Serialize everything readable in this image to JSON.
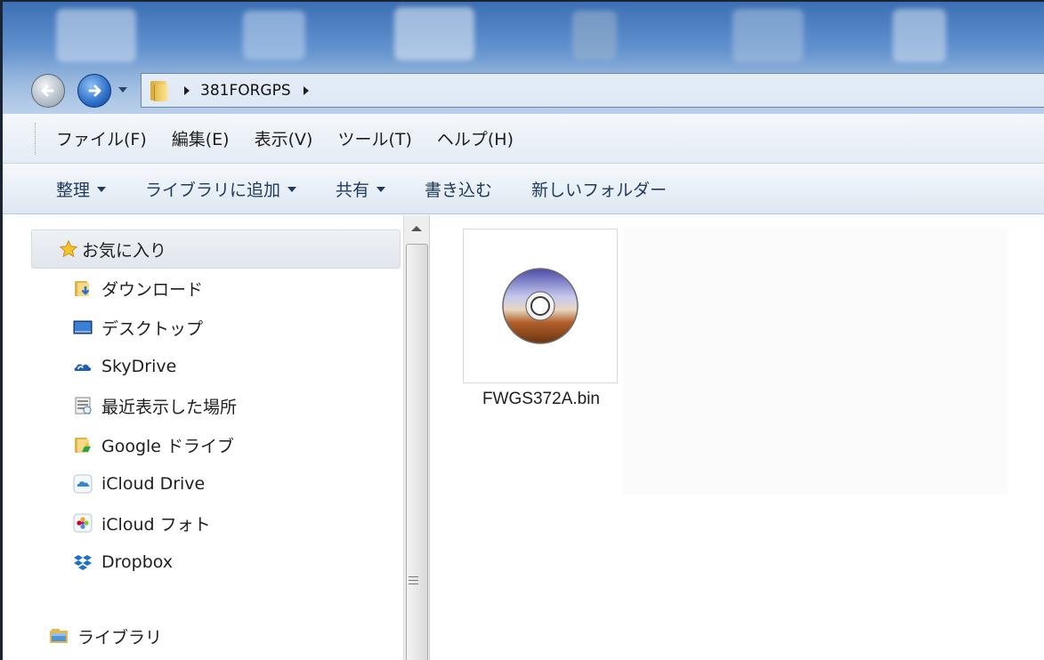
{
  "address_bar": {
    "breadcrumb": "381FORGPS"
  },
  "menu_bar": {
    "items": [
      "ファイル(F)",
      "編集(E)",
      "表示(V)",
      "ツール(T)",
      "ヘルプ(H)"
    ]
  },
  "command_bar": {
    "organize": "整理",
    "add_to_library": "ライブラリに追加",
    "share": "共有",
    "burn": "書き込む",
    "new_folder": "新しいフォルダー"
  },
  "navigation_pane": {
    "favorites_header": "お気に入り",
    "items": [
      {
        "label": "ダウンロード",
        "icon": "downloads-folder-icon"
      },
      {
        "label": "デスクトップ",
        "icon": "desktop-icon"
      },
      {
        "label": "SkyDrive",
        "icon": "skydrive-icon"
      },
      {
        "label": "最近表示した場所",
        "icon": "recent-places-icon"
      },
      {
        "label": "Google ドライブ",
        "icon": "google-drive-folder-icon"
      },
      {
        "label": "iCloud Drive",
        "icon": "icloud-drive-icon"
      },
      {
        "label": "iCloud フォト",
        "icon": "icloud-photos-icon"
      },
      {
        "label": "Dropbox",
        "icon": "dropbox-icon"
      }
    ],
    "library_label": "ライブラリ"
  },
  "content": {
    "files": [
      {
        "name": "FWGS372A.bin",
        "icon": "disc-image-icon"
      }
    ]
  },
  "colors": {
    "aero_blue": "#5b8ccb",
    "bar_background": "#e5ecf5",
    "command_text": "#1e3a5c"
  }
}
